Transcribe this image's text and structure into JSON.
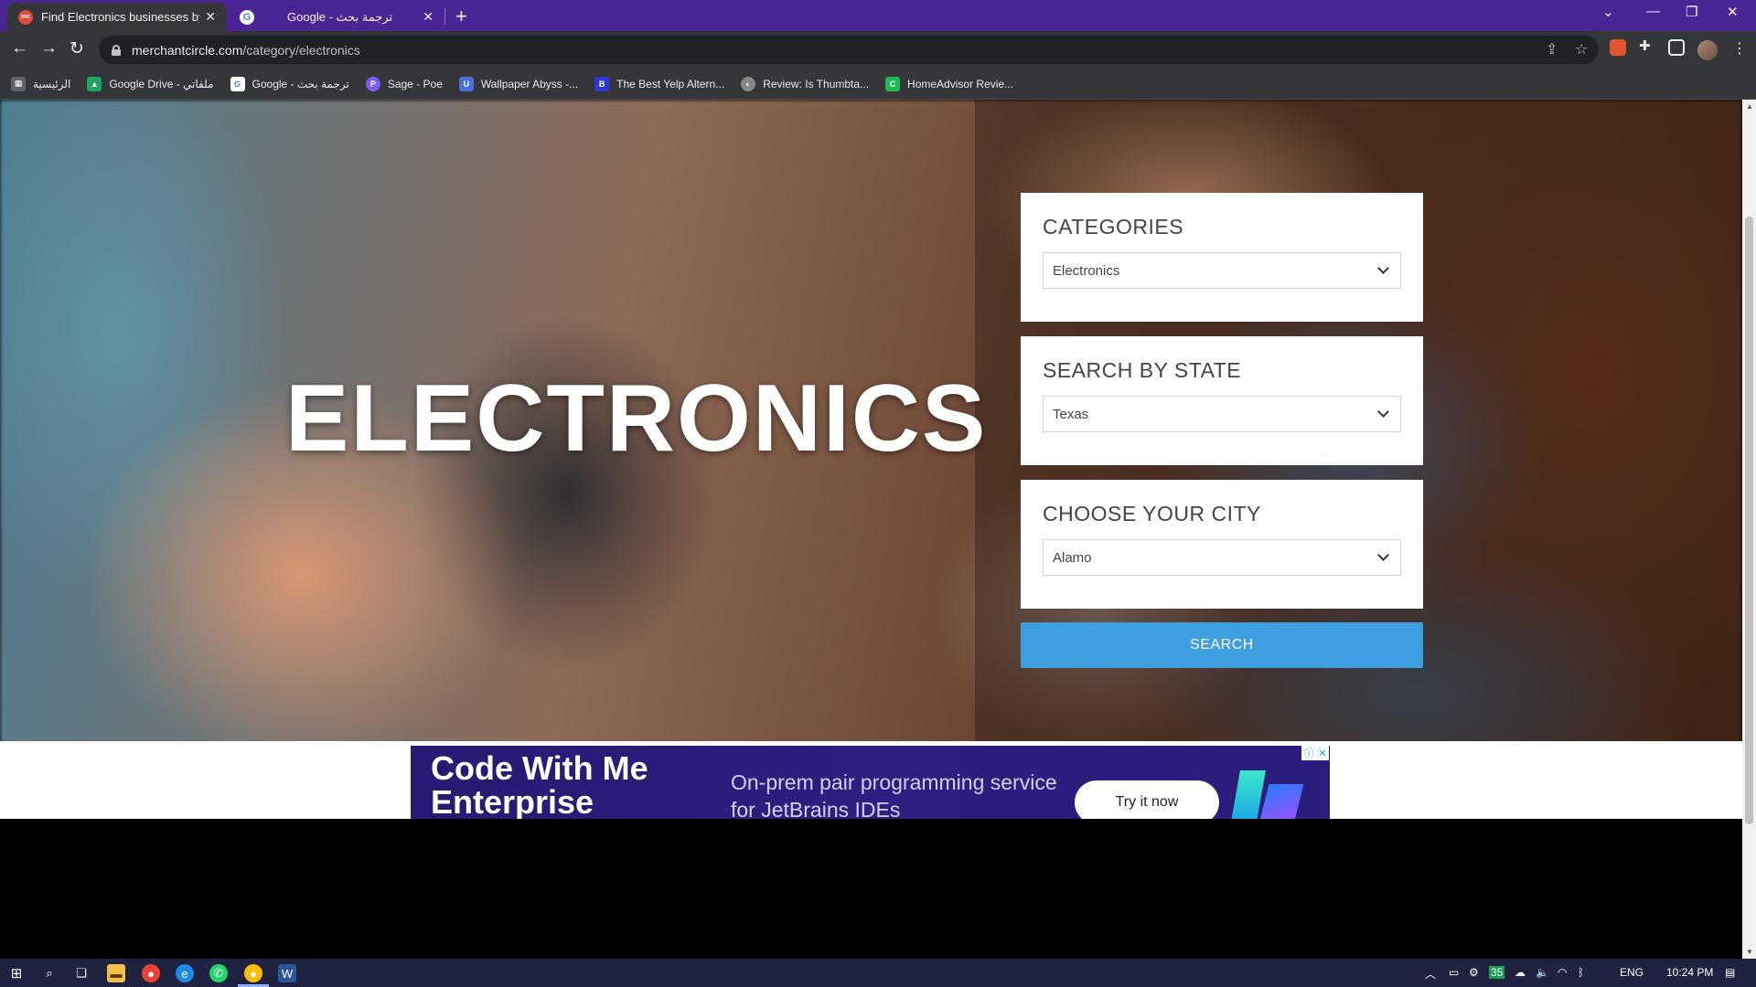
{
  "browser": {
    "tabs": [
      {
        "title": "Find Electronics businesses by Ci",
        "active": true,
        "favicon": "mc"
      },
      {
        "title": "Google - ترجمة بحث",
        "active": false,
        "favicon": "google"
      }
    ],
    "url_host": "merchantcircle.com",
    "url_path": "/category/electronics",
    "bookmarks": [
      {
        "label": "الرئيسية",
        "icon": "apps-grid-icon",
        "color": "#5f6368"
      },
      {
        "label": "Google Drive - ملفاتي",
        "icon": "drive-icon",
        "color": "#1fa463"
      },
      {
        "label": "Google - ترجمة بحث",
        "icon": "google-icon",
        "color": "#4285f4"
      },
      {
        "label": "Sage - Poe",
        "icon": "poe-icon",
        "color": "#7b5cf5"
      },
      {
        "label": "Wallpaper Abyss -...",
        "icon": "abyss-icon",
        "color": "#4a6fd6"
      },
      {
        "label": "The Best Yelp Altern...",
        "icon": "bd-icon",
        "color": "#2b3ad6"
      },
      {
        "label": "Review: Is Thumbta...",
        "icon": "review-icon",
        "color": "#888888"
      },
      {
        "label": "HomeAdvisor Revie...",
        "icon": "homeadvisor-icon",
        "color": "#1db954"
      }
    ]
  },
  "hero": {
    "title": "ELECTRONICS"
  },
  "filters": {
    "categories_label": "CATEGORIES",
    "categories_value": "Electronics",
    "state_label": "SEARCH BY STATE",
    "state_value": "Texas",
    "city_label": "CHOOSE YOUR CITY",
    "city_value": "Alamo",
    "search_label": "SEARCH"
  },
  "ad": {
    "headline": "Code With Me Enterprise",
    "sub": "On-prem pair programming service for JetBrains IDEs",
    "cta": "Try it now"
  },
  "taskbar": {
    "lang": "ENG",
    "time": "10:24 PM"
  },
  "colors": {
    "tabstrip": "#4a2594",
    "search_button": "#3d9ee0",
    "ad_background": "#2b1d7c",
    "taskbar": "#1f2240"
  }
}
